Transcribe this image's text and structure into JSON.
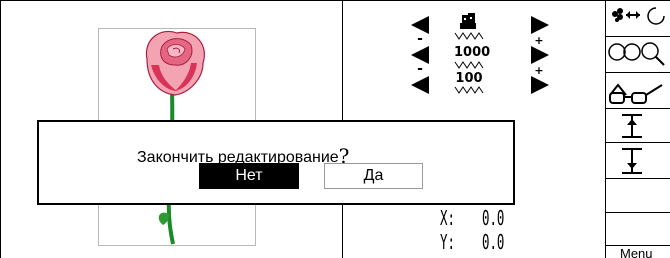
{
  "dialog": {
    "message": "Закончить редактирование",
    "question_mark": "?",
    "no_label": "Нет",
    "yes_label": "Да"
  },
  "controls": {
    "rows": [
      {
        "value": "",
        "minus": "-",
        "plus": "+"
      },
      {
        "value": "1000",
        "minus": "-",
        "plus": "+"
      },
      {
        "value": "100",
        "minus": "",
        "plus": ""
      }
    ]
  },
  "coords": {
    "x_label": "X:",
    "x_value": "0.0",
    "y_label": "Y:",
    "y_value": "0.0"
  },
  "sidebar": {
    "menu_label": "Menu"
  },
  "colors": {
    "rose_light": "#f4a3b3",
    "rose_dark": "#d8345a",
    "stem": "#1a8a2a",
    "leaf": "#2f9a33"
  }
}
